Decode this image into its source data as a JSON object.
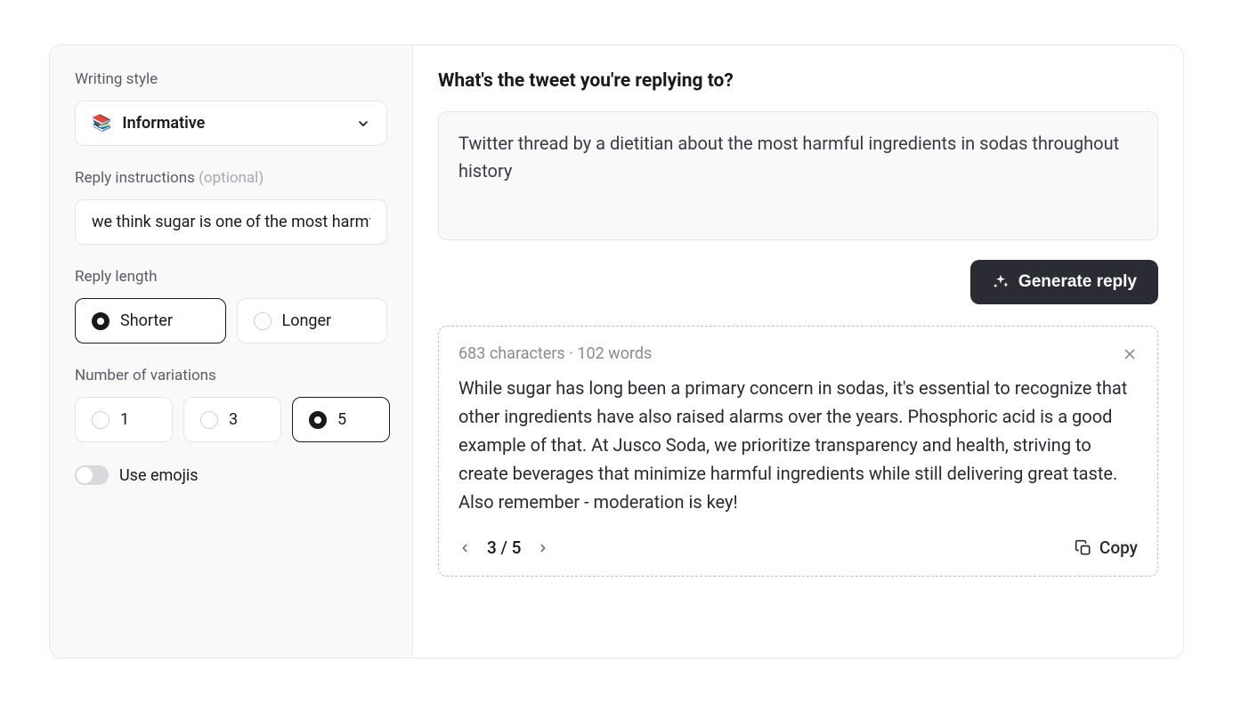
{
  "sidebar": {
    "writing_style": {
      "label": "Writing style",
      "icon": "📚",
      "selected": "Informative"
    },
    "reply_instructions": {
      "label": "Reply instructions",
      "optional": "(optional)",
      "value": "we think sugar is one of the most harmful"
    },
    "reply_length": {
      "label": "Reply length",
      "options": [
        "Shorter",
        "Longer"
      ],
      "selected": "Shorter"
    },
    "variations": {
      "label": "Number of variations",
      "options": [
        "1",
        "3",
        "5"
      ],
      "selected": "5"
    },
    "emojis": {
      "label": "Use emojis",
      "on": false
    }
  },
  "main": {
    "heading": "What's the tweet you're replying to?",
    "tweet_input": "Twitter thread by a dietitian about the most harmful ingredients in sodas throughout history",
    "generate_button": "Generate reply",
    "result": {
      "meta": "683 characters · 102 words",
      "body": "While sugar has long been a primary concern in sodas, it's essential to recognize that other ingredients have also raised alarms over the years. Phosphoric acid is a good example of that. At Jusco Soda, we prioritize transparency and health, striving to create beverages that minimize harmful ingredients while still delivering great taste. Also remember - moderation is key!",
      "page_current": "3",
      "page_total": "5",
      "copy_label": "Copy"
    }
  }
}
